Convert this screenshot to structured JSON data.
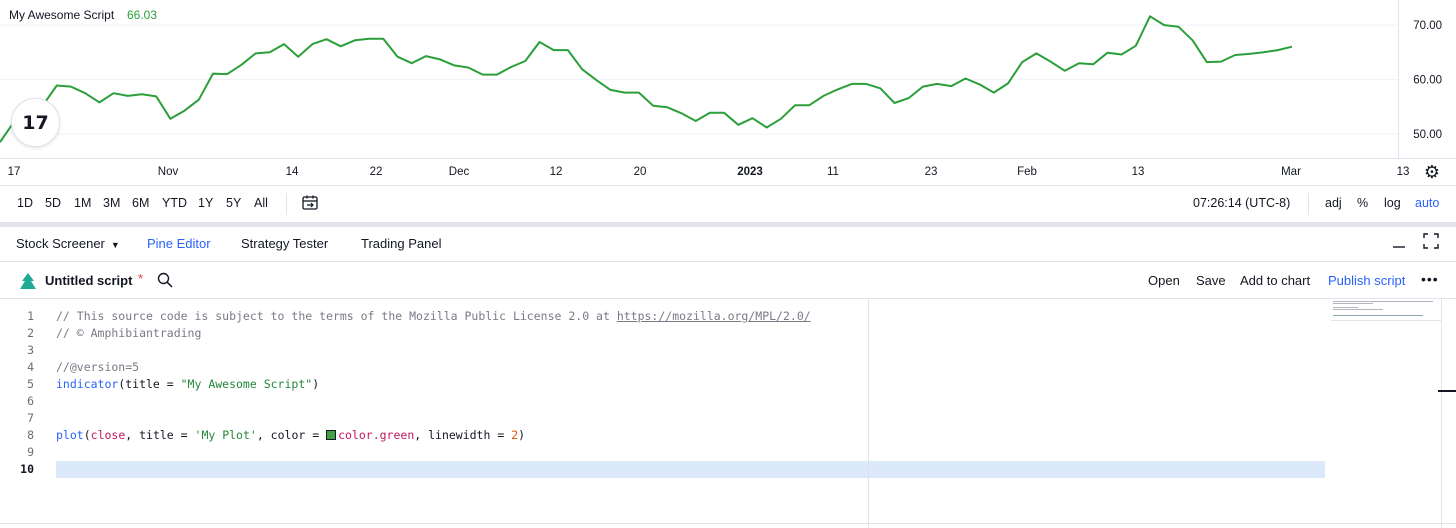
{
  "indicator": {
    "title": "My Awesome Script",
    "value": "66.03",
    "line_color": "#2b9f3a",
    "logo_icon": "tradingview-logo-icon"
  },
  "chart_data": {
    "type": "line",
    "series": [
      {
        "name": "My Awesome Script",
        "values": [
          48.5,
          52.3,
          53.0,
          55.2,
          58.9,
          58.7,
          57.5,
          55.8,
          57.5,
          57.0,
          57.3,
          56.9,
          52.8,
          54.3,
          56.3,
          61.1,
          61.0,
          62.7,
          64.8,
          65.0,
          66.5,
          64.2,
          66.5,
          67.4,
          66.1,
          67.2,
          67.5,
          67.5,
          64.2,
          63.0,
          64.3,
          63.7,
          62.6,
          62.2,
          60.9,
          60.9,
          62.3,
          63.4,
          66.9,
          65.4,
          65.4,
          61.9,
          59.9,
          58.1,
          57.6,
          57.6,
          55.2,
          54.9,
          53.8,
          52.4,
          53.9,
          53.9,
          51.7,
          52.9,
          51.2,
          52.8,
          55.3,
          55.3,
          57.0,
          58.2,
          59.2,
          59.2,
          58.4,
          55.7,
          56.6,
          58.7,
          59.2,
          58.8,
          60.2,
          59.1,
          57.6,
          59.3,
          63.2,
          64.8,
          63.3,
          61.6,
          63.0,
          62.8,
          64.9,
          64.6,
          66.2,
          71.6,
          70.0,
          69.7,
          67.2,
          63.2,
          63.3,
          64.5,
          64.7,
          65.0,
          65.4,
          66.03
        ]
      }
    ],
    "x_tick_labels": [
      "17",
      "Nov",
      "14",
      "22",
      "Dec",
      "12",
      "20",
      "2023",
      "11",
      "23",
      "Feb",
      "13",
      "Mar",
      "13"
    ],
    "y_tick_labels": [
      "50.00",
      "60.00",
      "70.00"
    ],
    "ylim": [
      45.6,
      74.6
    ],
    "grid": true,
    "xlabel": "",
    "ylabel": ""
  },
  "range_bar": {
    "ranges": [
      "1D",
      "5D",
      "1M",
      "3M",
      "6M",
      "YTD",
      "1Y",
      "5Y",
      "All"
    ],
    "time": "07:26:14 (UTC-8)",
    "options": [
      "adj",
      "%",
      "log",
      "auto"
    ],
    "active_option": "auto"
  },
  "panel_tabs": {
    "tabs": [
      "Stock Screener",
      "Pine Editor",
      "Strategy Tester",
      "Trading Panel"
    ],
    "active": "Pine Editor",
    "minimize_icon": "minimize-icon",
    "maximize_icon": "maximize-icon"
  },
  "editor_header": {
    "script_name": "Untitled script",
    "unsaved_mark": "*",
    "actions": [
      "Open",
      "Save",
      "Add to chart",
      "Publish script"
    ],
    "more_icon": "more-icon"
  },
  "code": {
    "line_numbers": [
      "1",
      "2",
      "3",
      "4",
      "5",
      "6",
      "7",
      "8",
      "9",
      "10"
    ],
    "current_line": "10",
    "l1_comment": "// This source code is subject to the terms of the Mozilla Public License 2.0 at ",
    "l1_link": "https://mozilla.org/MPL/2.0/",
    "l2": "// © Amphibiantrading",
    "l4": "//@version=5",
    "l5_func": "indicator",
    "l5_a": "(title = ",
    "l5_str": "\"My Awesome Script\"",
    "l5_b": ")",
    "l8_func": "plot",
    "l8_a": "(",
    "l8_close": "close",
    "l8_b": ", title = ",
    "l8_str": "'My Plot'",
    "l8_c": ", color = ",
    "l8_color": "color.green",
    "l8_d": ", linewidth = ",
    "l8_num": "2",
    "l8_e": ")"
  }
}
